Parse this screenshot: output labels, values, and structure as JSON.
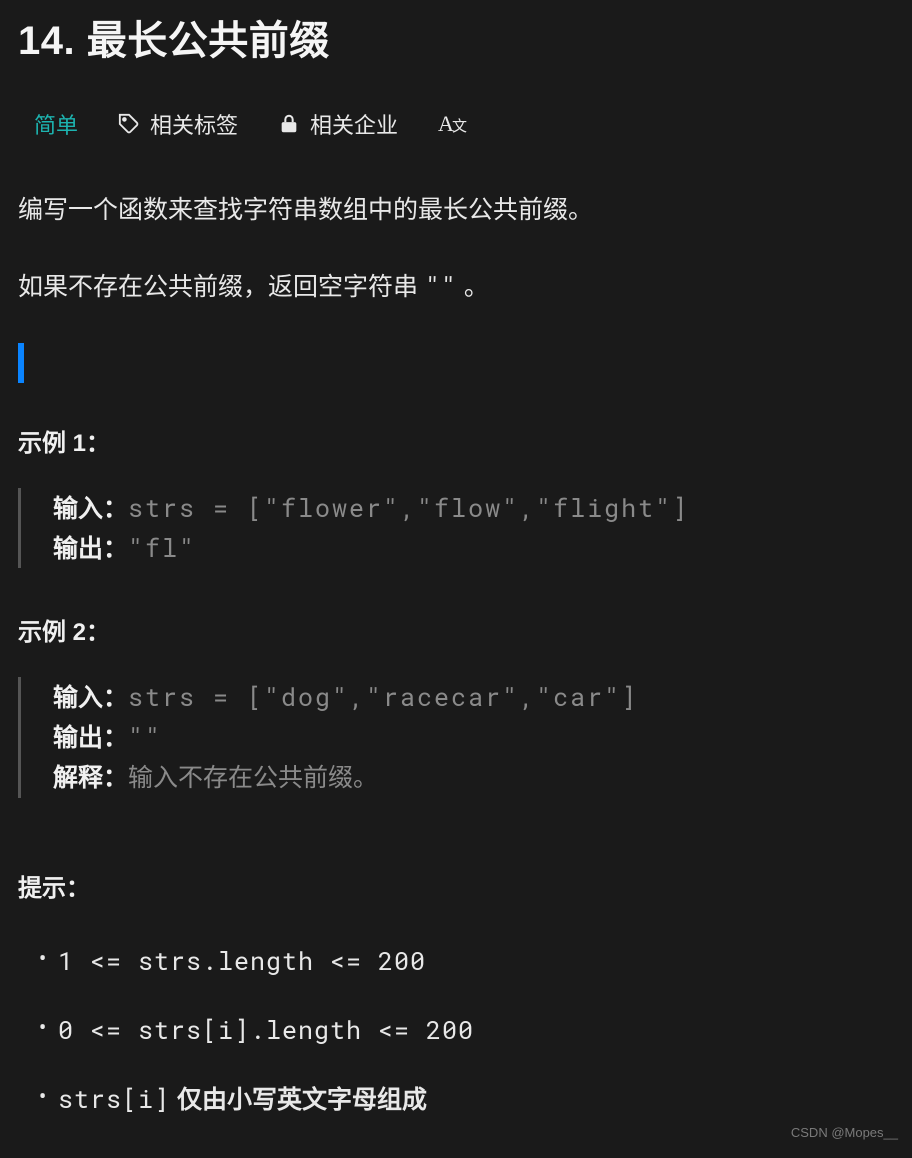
{
  "title": "14. 最长公共前缀",
  "tabs": {
    "difficulty": "简单",
    "tags": "相关标签",
    "companies": "相关企业"
  },
  "description": {
    "line1": "编写一个函数来查找字符串数组中的最长公共前缀。",
    "line2_pre": "如果不存在公共前缀，返回空字符串 ",
    "line2_code": "\"\"",
    "line2_post": " 。"
  },
  "examples": [
    {
      "title": "示例 1：",
      "input_label": "输入：",
      "input_value": "strs = [\"flower\",\"flow\",\"flight\"]",
      "output_label": "输出：",
      "output_value": "\"fl\""
    },
    {
      "title": "示例 2：",
      "input_label": "输入：",
      "input_value": "strs = [\"dog\",\"racecar\",\"car\"]",
      "output_label": "输出：",
      "output_value": "\"\"",
      "explain_label": "解释：",
      "explain_value": "输入不存在公共前缀。"
    }
  ],
  "hints": {
    "title": "提示：",
    "items": [
      {
        "code": "1 <= strs.length <= 200",
        "plain": ""
      },
      {
        "code": "0 <= strs[i].length <= 200",
        "plain": ""
      },
      {
        "code": "strs[i]",
        "plain": " 仅由小写英文字母组成"
      }
    ]
  },
  "watermark": "CSDN @Mopes__"
}
